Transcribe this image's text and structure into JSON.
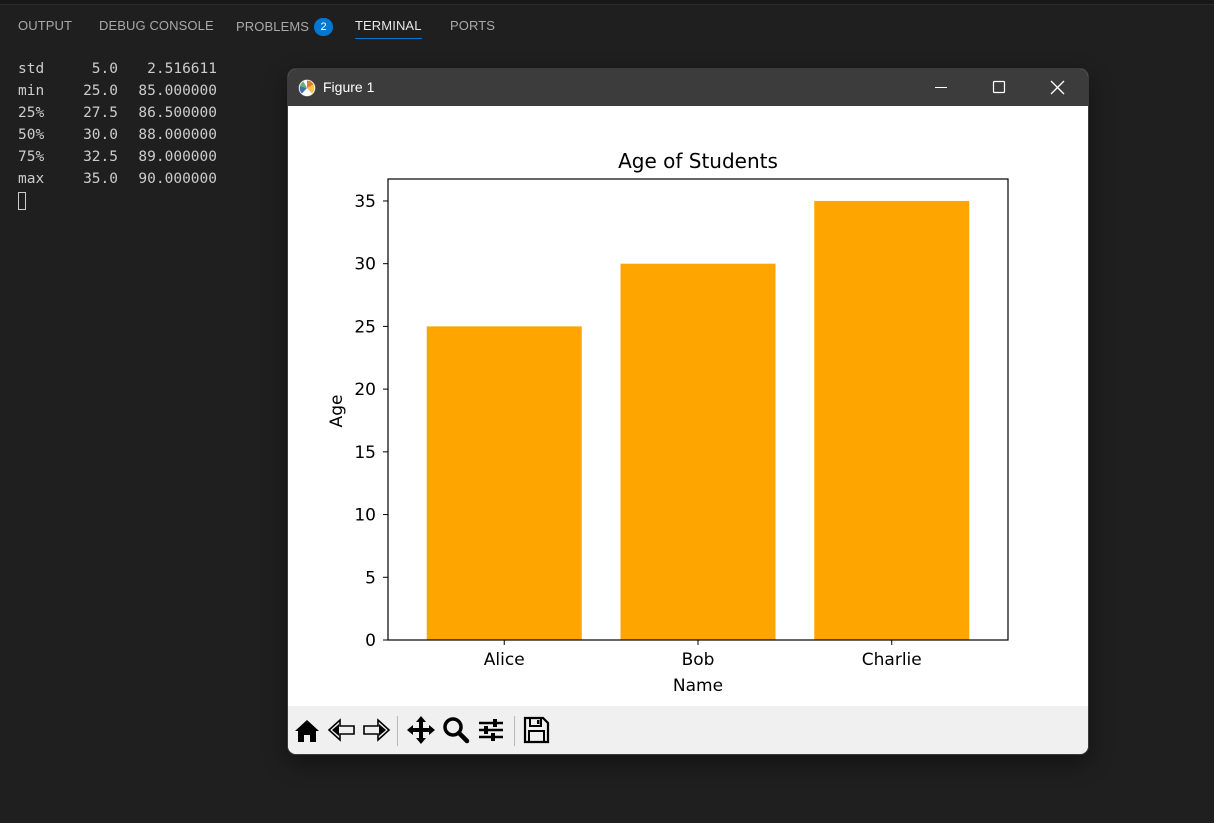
{
  "panel": {
    "tabs": [
      {
        "label": "OUTPUT"
      },
      {
        "label": "DEBUG CONSOLE"
      },
      {
        "label": "PROBLEMS",
        "badge": "2"
      },
      {
        "label": "TERMINAL",
        "active": true
      },
      {
        "label": "PORTS"
      }
    ]
  },
  "terminal": {
    "rows": [
      {
        "stat": "std",
        "age": "5.0",
        "score": "2.516611"
      },
      {
        "stat": "min",
        "age": "25.0",
        "score": "85.000000"
      },
      {
        "stat": "25%",
        "age": "27.5",
        "score": "86.500000"
      },
      {
        "stat": "50%",
        "age": "30.0",
        "score": "88.000000"
      },
      {
        "stat": "75%",
        "age": "32.5",
        "score": "89.000000"
      },
      {
        "stat": "max",
        "age": "35.0",
        "score": "90.000000"
      }
    ]
  },
  "figure_window": {
    "title": "Figure 1",
    "controls": {
      "minimize_icon": "minimize-icon",
      "maximize_icon": "maximize-icon",
      "close_icon": "close-icon"
    },
    "toolbar": [
      "home-icon",
      "back-arrow-icon",
      "forward-arrow-icon",
      "pan-move-icon",
      "zoom-magnifier-icon",
      "configure-subplots-icon",
      "save-icon"
    ]
  },
  "chart_data": {
    "type": "bar",
    "title": "Age of Students",
    "xlabel": "Name",
    "ylabel": "Age",
    "categories": [
      "Alice",
      "Bob",
      "Charlie"
    ],
    "values": [
      25,
      30,
      35
    ],
    "bar_color": "#ffa500",
    "ylim": [
      0,
      36.75
    ],
    "yticks": [
      0,
      5,
      10,
      15,
      20,
      25,
      30,
      35
    ],
    "grid": false
  }
}
